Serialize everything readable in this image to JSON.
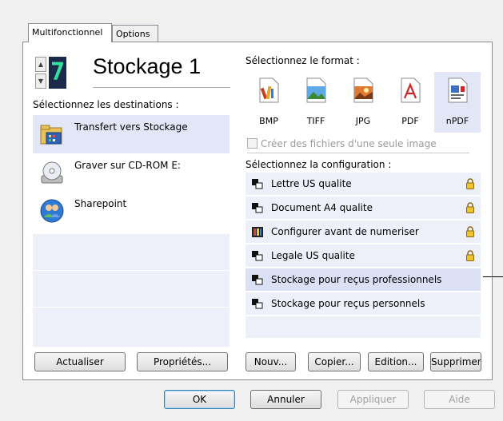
{
  "tabs": [
    {
      "label": "Multifonctionnel",
      "active": true
    },
    {
      "label": "Options",
      "active": false
    }
  ],
  "counter": {
    "digit": "7",
    "up_icon": "spin-up-icon",
    "down_icon": "spin-down-icon"
  },
  "title": "Stockage 1",
  "destinations": {
    "label": "Sélectionnez les destinations :",
    "items": [
      {
        "label": "Transfert vers Stockage",
        "icon": "folder-icon",
        "selected": true
      },
      {
        "label": "Graver sur CD-ROM  E:",
        "icon": "cd-icon",
        "selected": false
      },
      {
        "label": "Sharepoint",
        "icon": "people-icon",
        "selected": false
      }
    ]
  },
  "format": {
    "label": "Sélectionnez le format :",
    "items": [
      {
        "label": "BMP",
        "icon": "bmp-icon",
        "selected": false
      },
      {
        "label": "TIFF",
        "icon": "tiff-icon",
        "selected": false
      },
      {
        "label": "JPG",
        "icon": "jpg-icon",
        "selected": false
      },
      {
        "label": "PDF",
        "icon": "pdf-icon",
        "selected": false
      },
      {
        "label": "nPDF",
        "icon": "npdf-icon",
        "selected": true
      }
    ],
    "single_image_checkbox": "Créer des fichiers d'une seule image"
  },
  "config": {
    "label": "Sélectionnez la configuration :",
    "items": [
      {
        "label": "Lettre US qualite",
        "locked": true,
        "selected": false
      },
      {
        "label": "Document A4 qualite",
        "locked": true,
        "selected": false
      },
      {
        "label": "Configurer avant de numeriser",
        "locked": true,
        "selected": false
      },
      {
        "label": "Legale US qualite",
        "locked": true,
        "selected": false
      },
      {
        "label": "Stockage pour reçus professionnels",
        "locked": false,
        "selected": true
      },
      {
        "label": "Stockage pour reçus personnels",
        "locked": false,
        "selected": false
      }
    ]
  },
  "buttons": {
    "refresh": "Actualiser",
    "properties": "Propriétés...",
    "new": "Nouv...",
    "copy": "Copier...",
    "edit": "Edition...",
    "delete": "Supprimer",
    "ok": "OK",
    "cancel": "Annuler",
    "apply": "Appliquer",
    "help": "Aide"
  },
  "colors": {
    "selection": "#e2e6f6",
    "row_bg": "#eef0f9",
    "accent": "#3c7fb1"
  }
}
